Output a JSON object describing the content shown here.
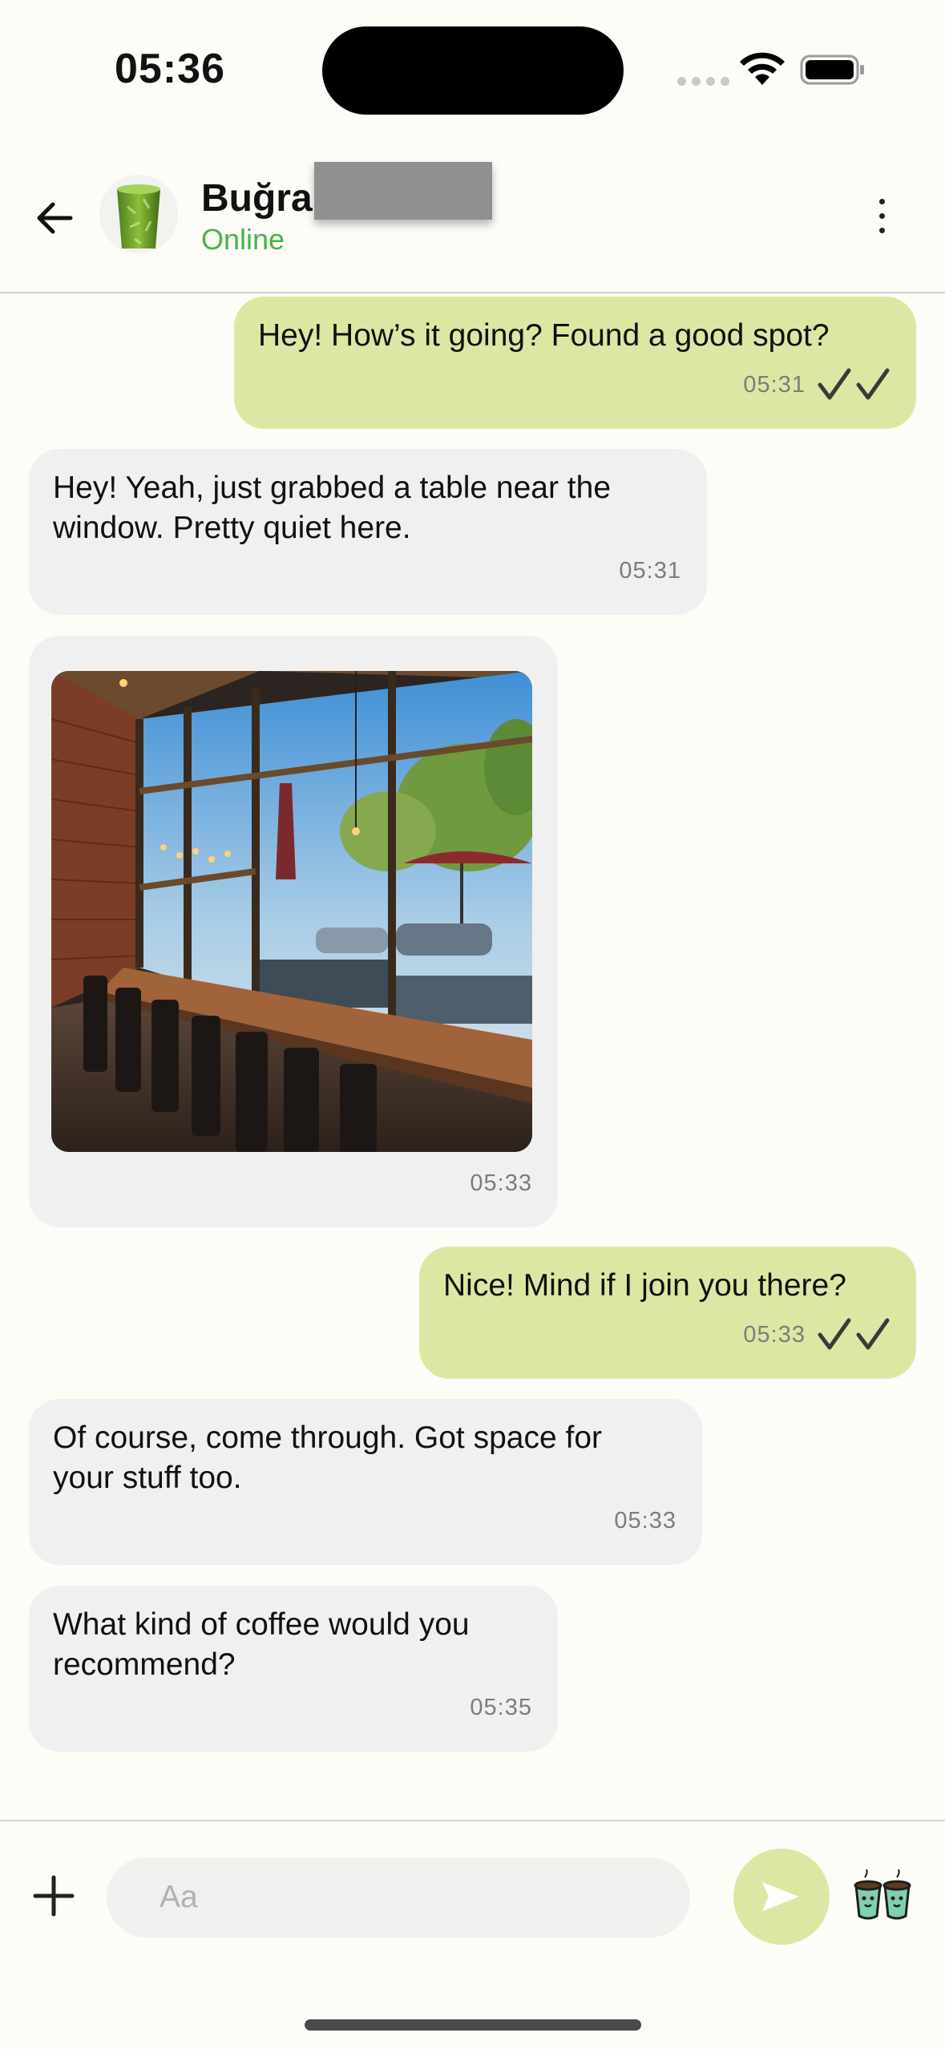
{
  "status_bar": {
    "time": "05:36"
  },
  "header": {
    "contact_name": "Buğra",
    "presence": "Online"
  },
  "messages": [
    {
      "direction": "out",
      "text": "Hey! How’s it going? Found a good spot?",
      "time": "05:31",
      "read": true
    },
    {
      "direction": "in",
      "text": "Hey! Yeah, just grabbed a table near the\nwindow. Pretty quiet here.",
      "time": "05:31"
    },
    {
      "direction": "in",
      "type": "image",
      "caption": "",
      "time": "05:33"
    },
    {
      "direction": "out",
      "text": "Nice! Mind if I join you there?",
      "time": "05:33",
      "read": true
    },
    {
      "direction": "in",
      "text": "Of course, come through. Got space for\nyour stuff too.",
      "time": "05:33"
    },
    {
      "direction": "in",
      "text": "What kind of coffee would you\nrecommend?",
      "time": "05:35"
    }
  ],
  "composer": {
    "placeholder": "Aa"
  },
  "colors": {
    "outgoing_bubble": "#dbe8a4",
    "incoming_bubble": "#f0f0f0",
    "online": "#45b447",
    "background": "#fdfcf7"
  },
  "icons": [
    "back-arrow-icon",
    "more-vertical-icon",
    "read-receipt-icon",
    "plus-icon",
    "send-icon",
    "coffee-cups-sticker-icon",
    "wifi-icon",
    "battery-icon"
  ]
}
